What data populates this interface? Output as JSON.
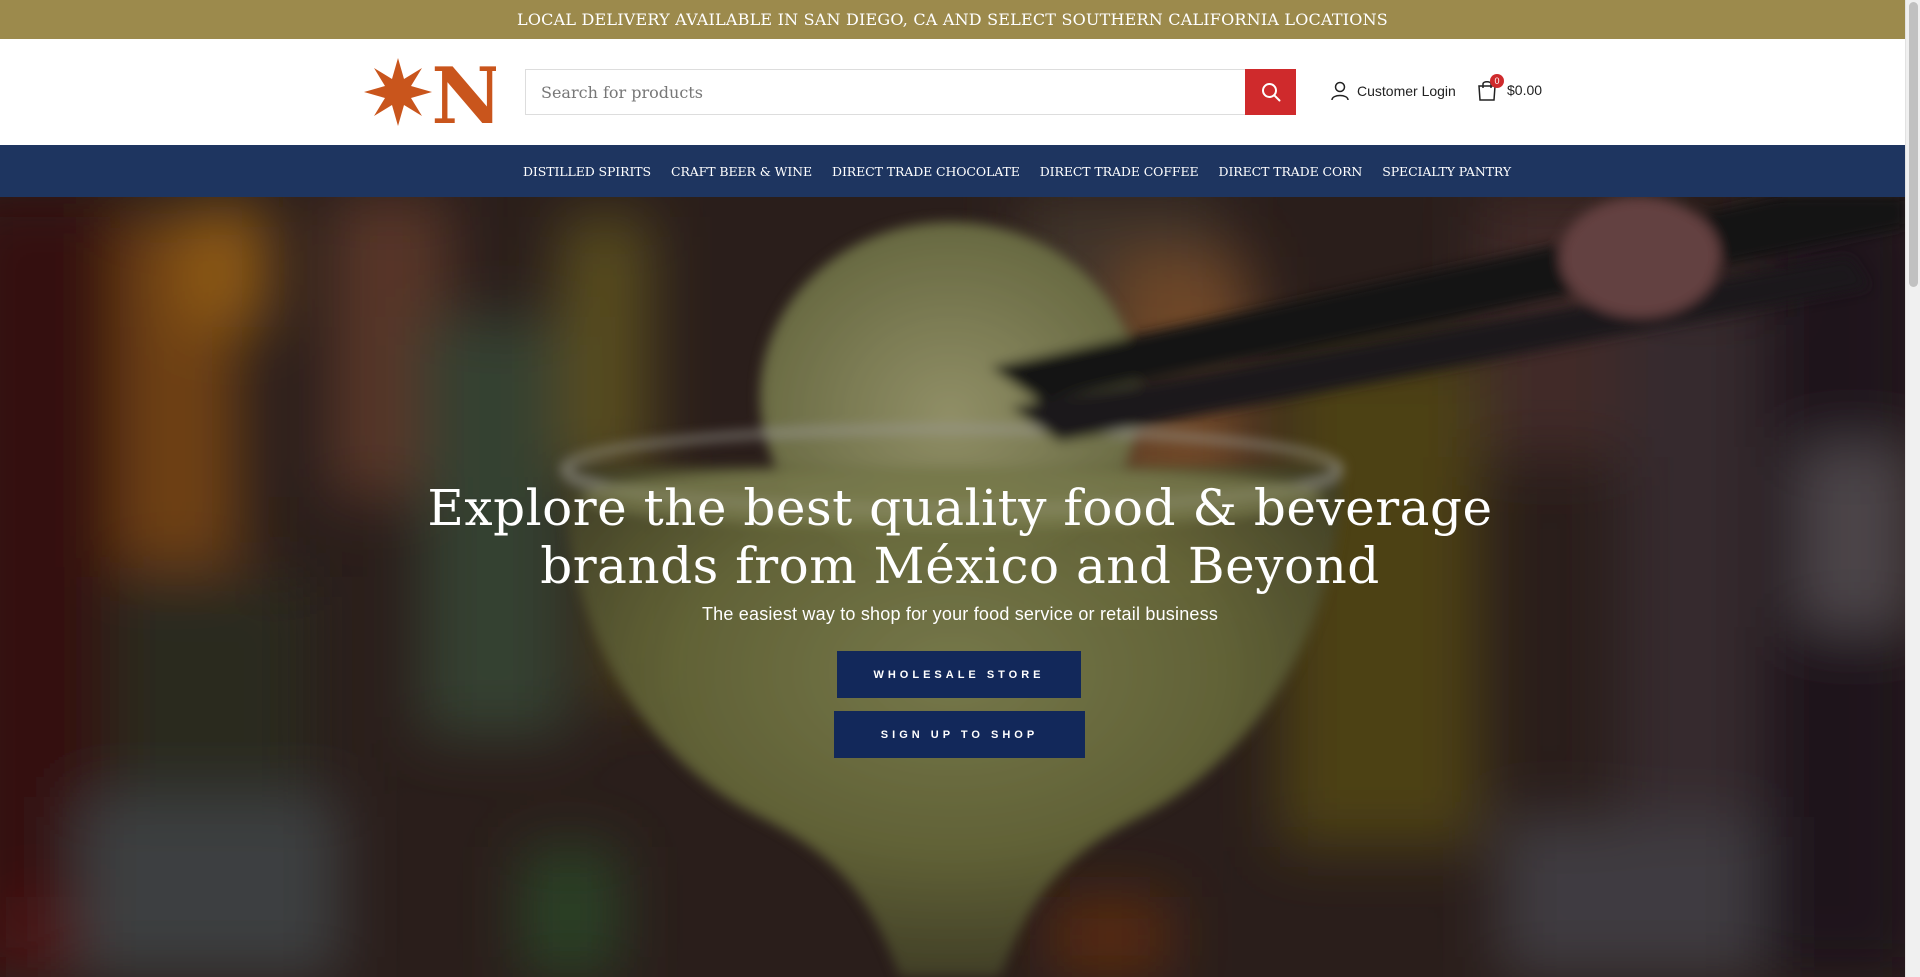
{
  "topbar": {
    "text": "LOCAL DELIVERY AVAILABLE IN SAN DIEGO, CA AND SELECT SOUTHERN CALIFORNIA LOCATIONS"
  },
  "header": {
    "logo_letter": "N",
    "search_placeholder": "Search for products",
    "login_label": "Customer Login",
    "cart_count": "0",
    "cart_total": "$0.00"
  },
  "nav": {
    "items": [
      "DISTILLED SPIRITS",
      "CRAFT BEER & WINE",
      "DIRECT TRADE CHOCOLATE",
      "DIRECT TRADE COFFEE",
      "DIRECT TRADE CORN",
      "SPECIALTY PANTRY"
    ]
  },
  "hero": {
    "title_line1": "Explore the best quality food & beverage",
    "title_line2": "brands from México and Beyond",
    "subtitle": "The easiest way to shop for your food service or retail business",
    "btn_wholesale": "WHOLESALE STORE",
    "btn_signup": "SIGN UP TO SHOP"
  },
  "colors": {
    "topbar": "#9c8a4c",
    "nav": "#1e3560",
    "search_button": "#cf2a2c",
    "hero_button": "#12285a",
    "logo": "#c9551c"
  }
}
